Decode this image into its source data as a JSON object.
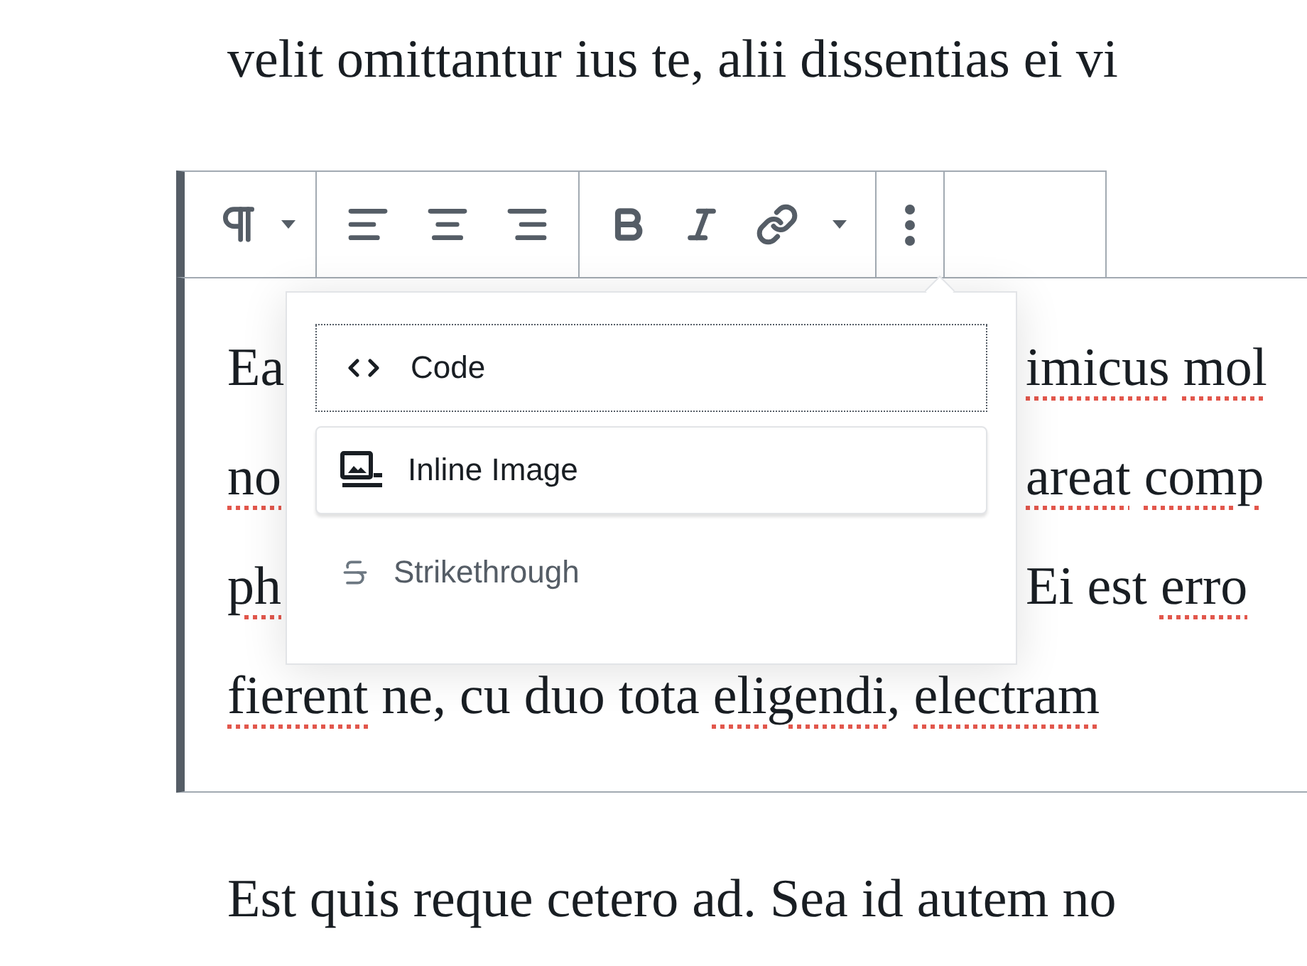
{
  "lines_above": [
    {
      "segments": [
        {
          "text": "velit omittantur ius te, alii dissentias ei vi",
          "misspelled": false
        }
      ]
    }
  ],
  "block": {
    "selected": true,
    "lines": [
      {
        "left": [
          {
            "text": "Ea",
            "misspelled": false
          }
        ],
        "right": [
          {
            "text": "imicus",
            "misspelled": true
          },
          {
            "text": "mol",
            "misspelled": true
          }
        ]
      },
      {
        "left": [
          {
            "text": "no",
            "misspelled": true
          }
        ],
        "right": [
          {
            "text": "areat",
            "misspelled": true
          },
          {
            "text": "comp",
            "misspelled": true
          }
        ]
      },
      {
        "left": [
          {
            "text": "ph",
            "misspelled": true
          }
        ],
        "right": [
          {
            "text": "Ei est",
            "misspelled": false
          },
          {
            "text": "erro",
            "misspelled": true
          }
        ]
      },
      {
        "left": [
          {
            "text": "fierent",
            "misspelled": true
          },
          {
            "text": " ne, cu duo tota ",
            "misspelled": false
          },
          {
            "text": "eligendi",
            "misspelled": true
          },
          {
            "text": ", ",
            "misspelled": false
          },
          {
            "text": "electram",
            "misspelled": true
          }
        ]
      }
    ]
  },
  "format_menu": {
    "items": [
      {
        "label": "Code",
        "focused": true,
        "hovered": false,
        "disabled": false
      },
      {
        "label": "Inline Image",
        "focused": false,
        "hovered": true,
        "disabled": false
      },
      {
        "label": "Strikethrough",
        "focused": false,
        "hovered": false,
        "disabled": true
      }
    ]
  },
  "lines_below": [
    {
      "segments": [
        {
          "text": "Est quis reque cetero ad. Sea id autem no",
          "misspelled": false
        }
      ]
    }
  ]
}
